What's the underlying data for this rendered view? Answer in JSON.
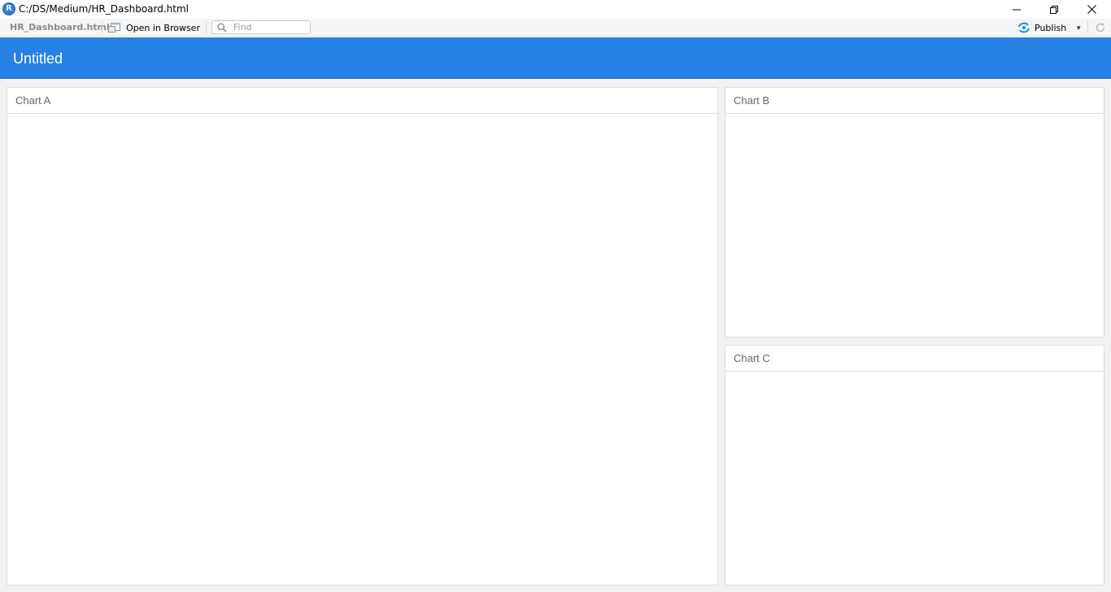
{
  "window": {
    "title": "C:/DS/Medium/HR_Dashboard.html",
    "app_icon_letter": "R"
  },
  "toolbar": {
    "file_name": "HR_Dashboard.html",
    "open_in_browser_label": "Open in Browser",
    "find_placeholder": "Find",
    "publish_label": "Publish"
  },
  "dashboard": {
    "title": "Untitled",
    "charts": [
      {
        "title": "Chart A"
      },
      {
        "title": "Chart B"
      },
      {
        "title": "Chart C"
      }
    ]
  },
  "colors": {
    "navbar": "#2780e3",
    "background": "#f2f2f2",
    "publish_icon": "#1a8fd6"
  },
  "icons": {
    "app": "rstudio-icon",
    "minimize": "minimize-icon",
    "maximize": "restore-icon",
    "close": "close-icon",
    "open_in_browser": "browser-window-icon",
    "find": "search-icon",
    "publish": "publish-icon",
    "publish_menu": "chevron-down-icon",
    "refresh": "refresh-icon"
  }
}
